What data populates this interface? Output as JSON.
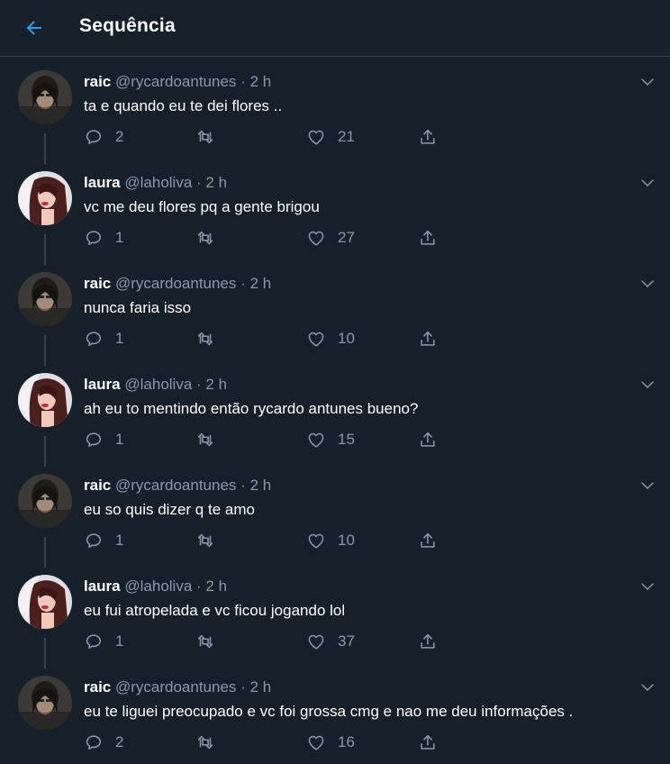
{
  "header": {
    "title": "Sequência"
  },
  "colors": {
    "background": "#15202b",
    "accent": "#1da1f2",
    "muted": "#8899a6",
    "divider": "#38444d"
  },
  "icons": {
    "back": "arrow-left-icon",
    "more": "chevron-down-icon",
    "reply": "reply-icon",
    "retweet": "retweet-icon",
    "like": "heart-icon",
    "share": "share-icon"
  },
  "tweets": [
    {
      "name": "raic",
      "handle": "@rycardoantunes",
      "sep": "·",
      "time": "2 h",
      "text": "ta e quando eu te dei flores ..",
      "replies": "2",
      "likes": "21"
    },
    {
      "name": "laura",
      "handle": "@laholiva",
      "sep": "·",
      "time": "2 h",
      "text": "vc me deu flores pq a gente brigou",
      "replies": "1",
      "likes": "27"
    },
    {
      "name": "raic",
      "handle": "@rycardoantunes",
      "sep": "·",
      "time": "2 h",
      "text": "nunca faria isso",
      "replies": "1",
      "likes": "10"
    },
    {
      "name": "laura",
      "handle": "@laholiva",
      "sep": "·",
      "time": "2 h",
      "text": "ah eu to mentindo então rycardo antunes bueno?",
      "replies": "1",
      "likes": "15"
    },
    {
      "name": "raic",
      "handle": "@rycardoantunes",
      "sep": "·",
      "time": "2 h",
      "text": "eu so quis dizer q te amo",
      "replies": "1",
      "likes": "10"
    },
    {
      "name": "laura",
      "handle": "@laholiva",
      "sep": "·",
      "time": "2 h",
      "text": "eu fui atropelada e vc ficou jogando lol",
      "replies": "1",
      "likes": "37"
    },
    {
      "name": "raic",
      "handle": "@rycardoantunes",
      "sep": "·",
      "time": "2 h",
      "text": "eu te liguei preocupado e vc foi grossa cmg e nao me deu informações .",
      "replies": "2",
      "likes": "16"
    }
  ]
}
